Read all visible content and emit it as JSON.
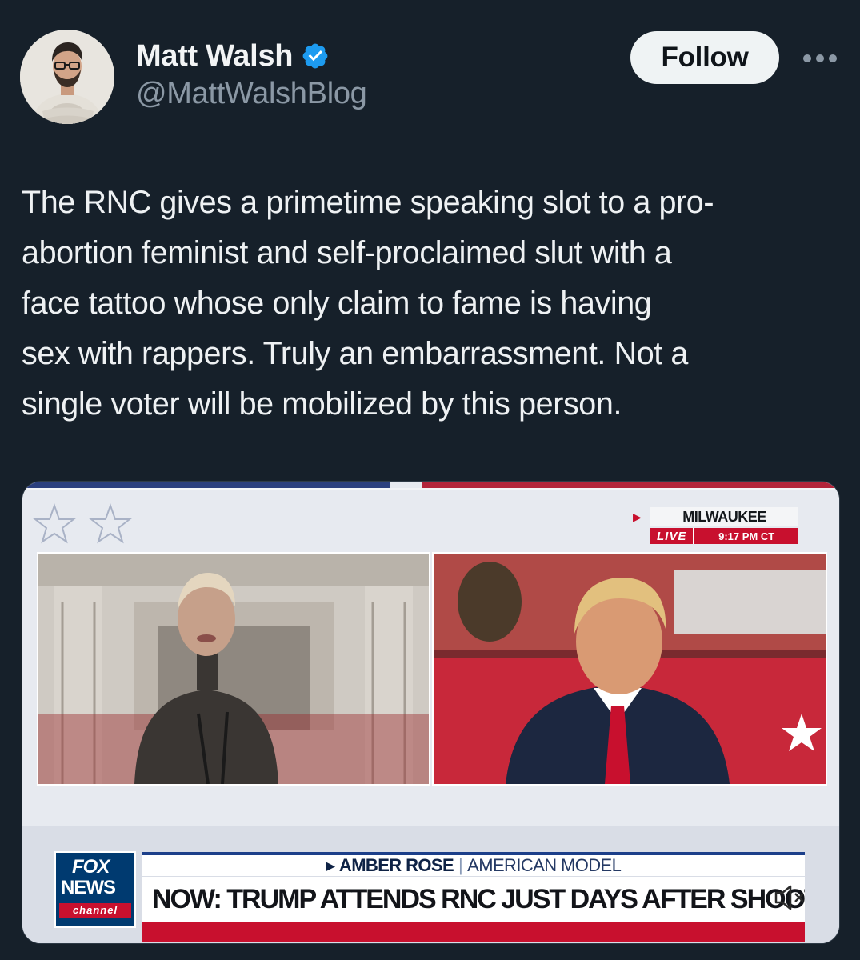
{
  "author": {
    "display_name": "Matt Walsh",
    "handle": "@MattWalshBlog",
    "verified": true,
    "avatar_icon": "user-avatar"
  },
  "actions": {
    "follow_label": "Follow",
    "more_icon": "more-horizontal-icon"
  },
  "tweet": {
    "text": "The RNC gives a primetime speaking slot to a pro-\nabortion feminist and self-proclaimed slut with a\nface tattoo whose only claim to fame is having\nsex with rappers. Truly an embarrassment. Not a\nsingle voter will be mobilized by this person."
  },
  "media": {
    "type": "video",
    "live_location": "MILWAUKEE",
    "live_label": "LIVE",
    "live_time": "9:17 PM CT",
    "network_logo": {
      "line1": "FOX",
      "line2": "NEWS",
      "line3": "channel"
    },
    "lower_third_name": "AMBER ROSE",
    "lower_third_role": "AMERICAN MODEL",
    "headline": "NOW: TRUMP ATTENDS RNC JUST DAYS AFTER SHOOTING",
    "mute_icon": "muted-speaker-icon"
  },
  "colors": {
    "background": "#16202a",
    "text_primary": "#e7e9ea",
    "text_secondary": "#8b98a5",
    "verified_blue": "#1d9bf0",
    "follow_bg": "#eff3f4",
    "fox_blue": "#003a70",
    "fox_red": "#c8102e"
  }
}
